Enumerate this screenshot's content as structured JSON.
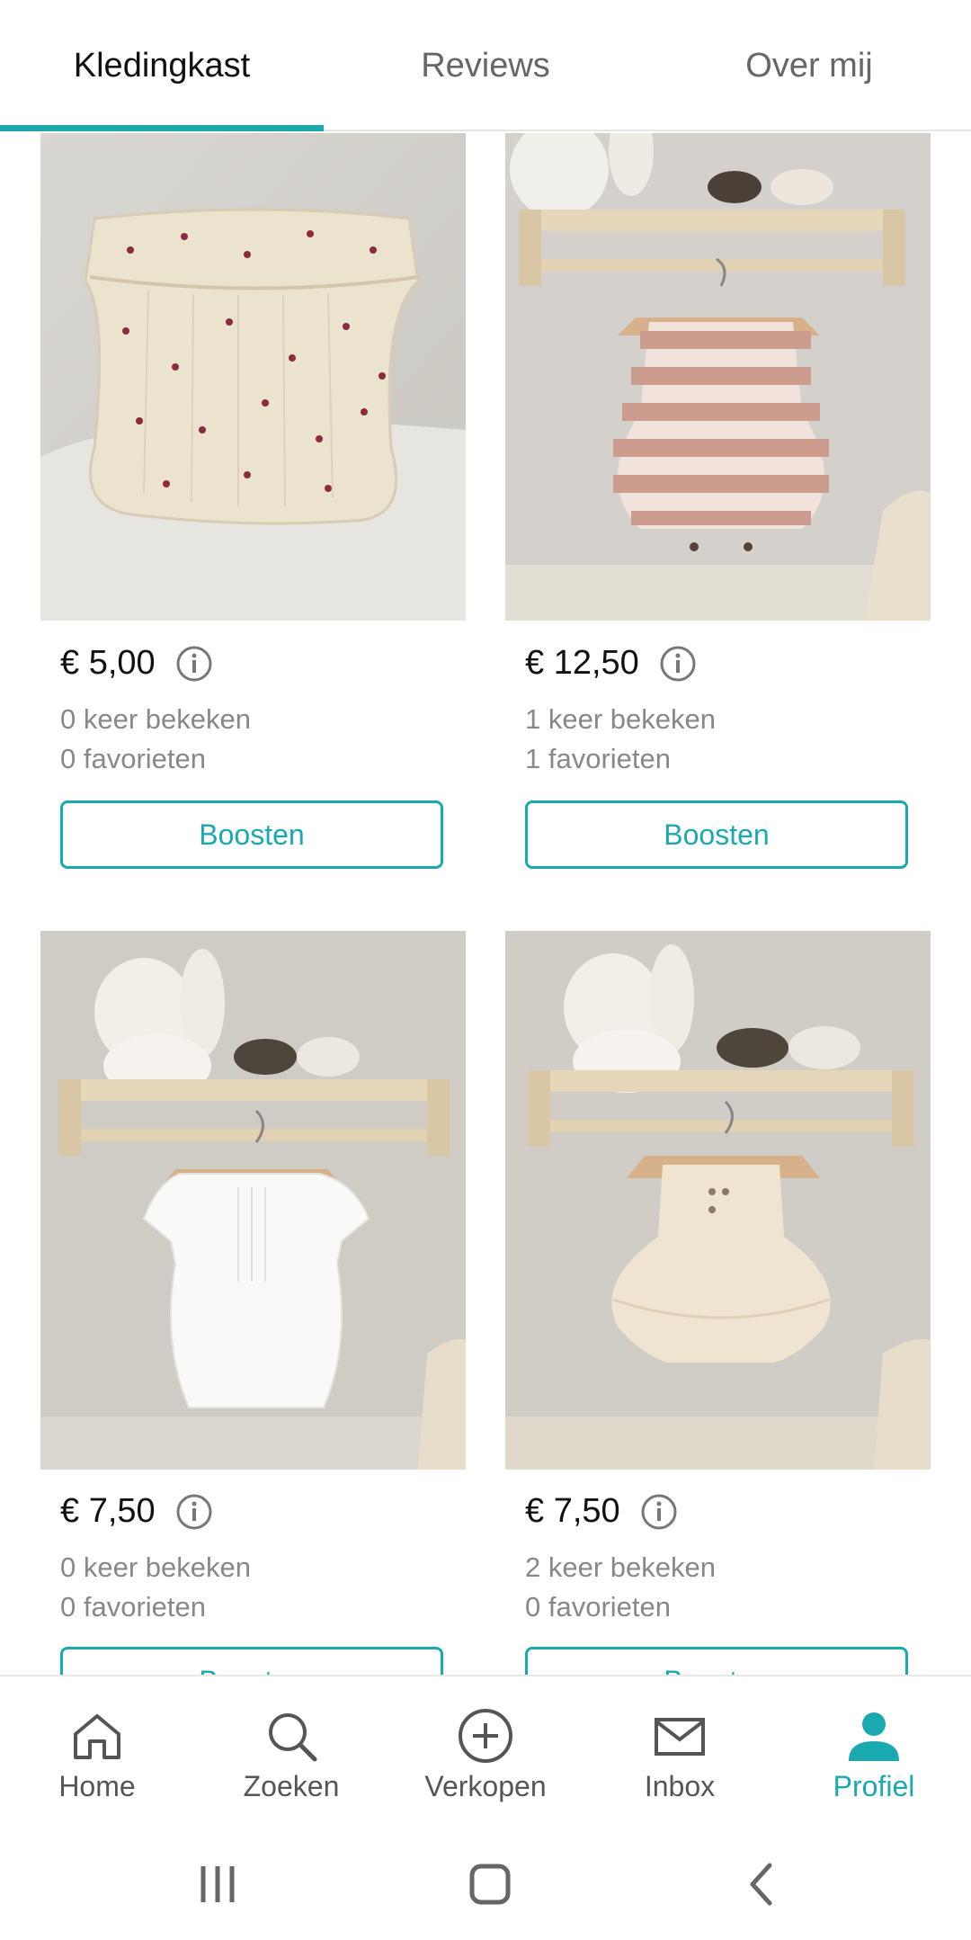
{
  "tabs": [
    {
      "label": "Kledingkast",
      "active": true
    },
    {
      "label": "Reviews",
      "active": false
    },
    {
      "label": "Over mij",
      "active": false
    }
  ],
  "items": [
    {
      "price": "€ 5,00",
      "views": "0 keer bekeken",
      "favorites": "0 favorieten",
      "button": "Boosten"
    },
    {
      "price": "€ 12,50",
      "views": "1 keer bekeken",
      "favorites": "1 favorieten",
      "button": "Boosten"
    },
    {
      "price": "€ 7,50",
      "views": "0 keer bekeken",
      "favorites": "0 favorieten",
      "button": "Boosten"
    },
    {
      "price": "€ 7,50",
      "views": "2 keer bekeken",
      "favorites": "0 favorieten",
      "button": "Boosten"
    }
  ],
  "bottom_nav": [
    {
      "label": "Home",
      "icon": "home-icon"
    },
    {
      "label": "Zoeken",
      "icon": "search-icon"
    },
    {
      "label": "Verkopen",
      "icon": "plus-circle-icon"
    },
    {
      "label": "Inbox",
      "icon": "mail-icon"
    },
    {
      "label": "Profiel",
      "icon": "profile-icon",
      "active": true
    }
  ],
  "colors": {
    "accent": "#1aa9b0",
    "muted_text": "#888888"
  }
}
